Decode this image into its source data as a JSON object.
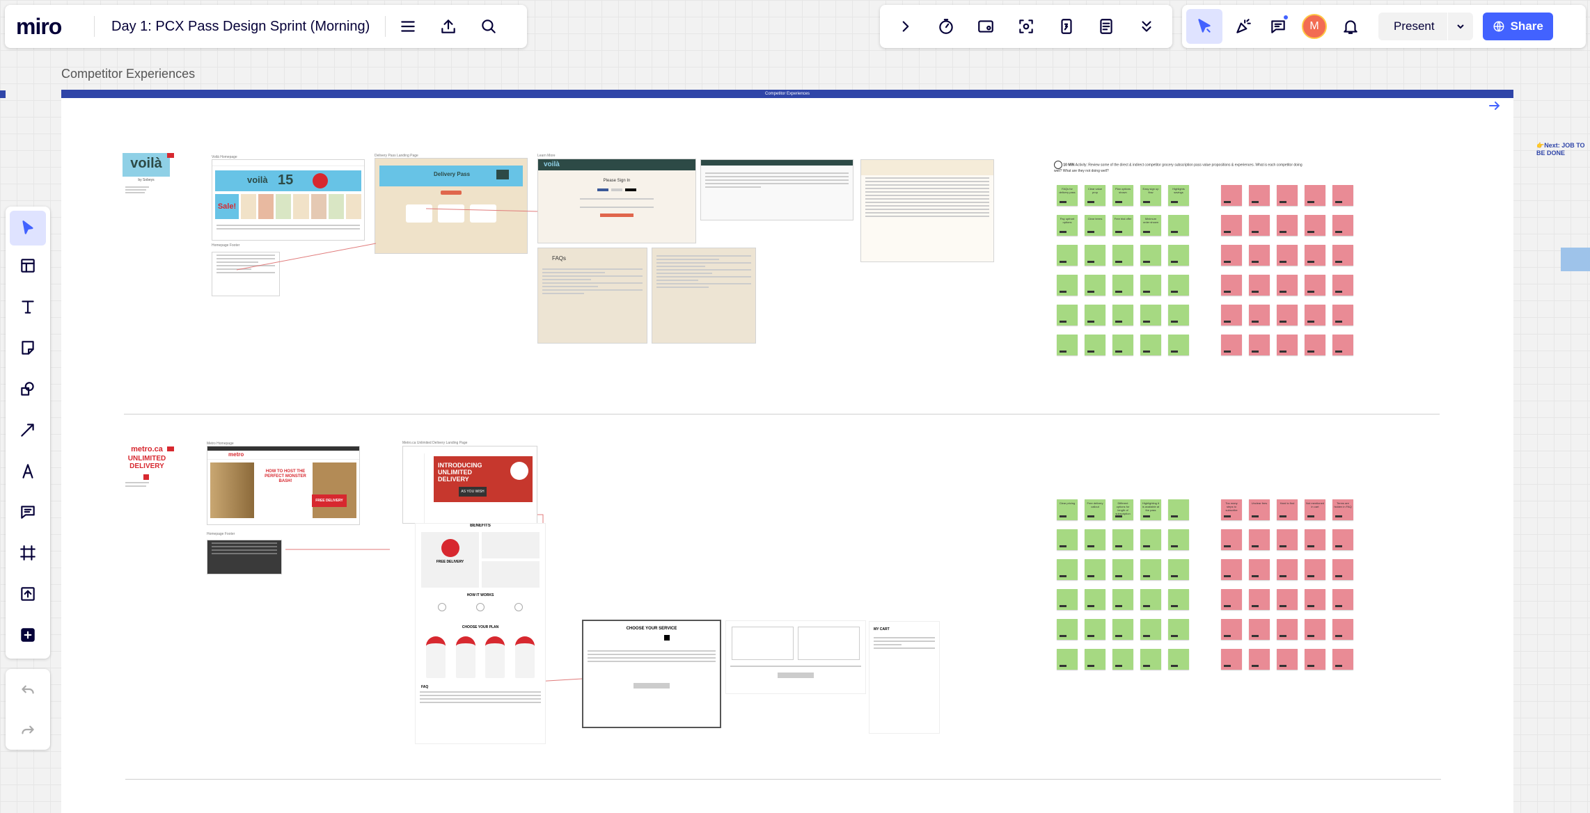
{
  "app": {
    "logo": "miro",
    "board_title": "Day 1: PCX Pass Design Sprint (Morning)"
  },
  "top_right": {
    "avatar_initial": "M",
    "present_label": "Present",
    "share_label": "Share"
  },
  "canvas": {
    "frame_label": "Competitor Experiences",
    "frame_header_text": "Competitor Experiences",
    "next_label": "👉Next: JOB TO BE DONE",
    "voila": {
      "logo": "voilà",
      "byline": "by Sobeys",
      "section_homepage": "Voilà Homepage",
      "section_landing": "Delivery Pass Landing Page",
      "section_learn": "Learn More",
      "promo_number": "15",
      "sale_text": "Sale!",
      "welcome_text": "Delivery Pass",
      "signin_title": "Please Sign In",
      "faqs_title": "FAQs",
      "section_footer": "Homepage Footer"
    },
    "activity": {
      "time": "10 MIN",
      "text": "Activity: Review some of the direct & indirect competitor grocery subscription pass value propositions & experiences. What is each competitor doing well? What are they not doing well?"
    },
    "voila_green_notes": [
      "FAQs for delivery pass",
      "Clear value prop",
      "Plan options shown",
      "Easy sign up flow",
      "Highlights savings",
      "Pay upfront options",
      "Clear terms",
      "Free trial offer",
      "Minimum order shown"
    ],
    "metro": {
      "logo": "metro.ca",
      "headline": "UNLIMITED DELIVERY",
      "section_homepage": "Metro Homepage",
      "section_landing": "Metro.ca Unlimited Delivery Landing Page",
      "hero_text": "HOW TO HOST THE PERFECT MONSTER BASH!",
      "free_delivery": "FREE DELIVERY",
      "intro_title": "INTRODUCING UNLIMITED DELIVERY",
      "as_you_wish": "AS YOU WISH",
      "benefits": "BENEFITS",
      "how_it_works": "HOW IT WORKS",
      "choose_plan": "CHOOSE YOUR PLAN",
      "faq": "FAQ",
      "choose_service": "CHOOSE YOUR SERVICE",
      "my_cart": "MY CART",
      "section_footer": "Homepage Footer"
    },
    "metro_green_notes": [
      "Clear pricing",
      "Free delivery callout",
      "Different options for length of subscription",
      "Highlighting it is available at the pass"
    ],
    "metro_red_notes": [
      "Too many steps to subscribe",
      "Unclear fees",
      "Hard to find",
      "Not mentioned in cart",
      "Terms are hidden in FAQ"
    ]
  },
  "colors": {
    "accent": "#4262ff",
    "frame_header": "#2f45a8",
    "sticky_green": "#a6d982",
    "sticky_red": "#e98b95",
    "metro_red": "#d7282f",
    "voila_teal": "#2d4a46"
  }
}
